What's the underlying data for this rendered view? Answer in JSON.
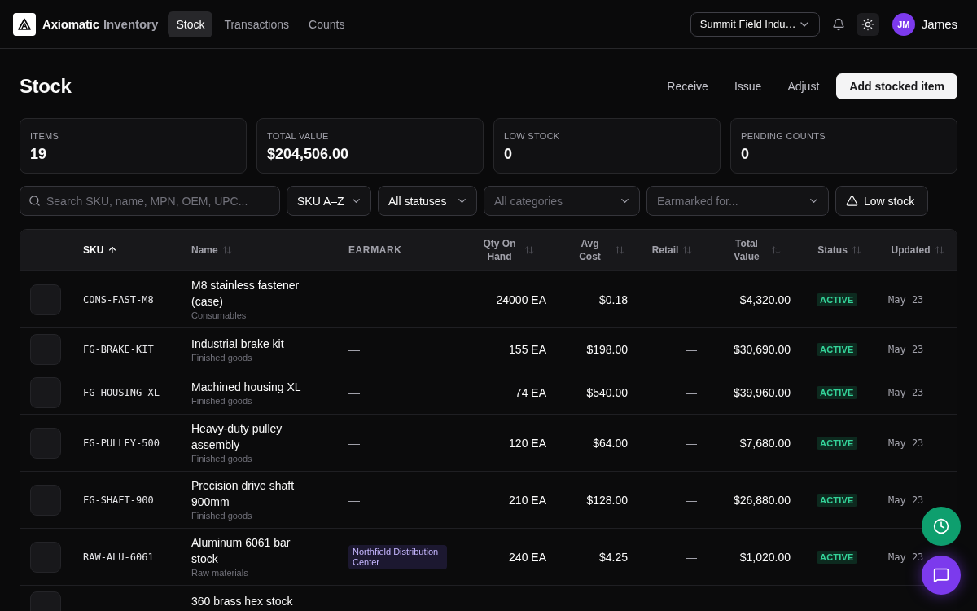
{
  "app": {
    "brand": "Axiomatic",
    "product": "Inventory"
  },
  "nav": {
    "tabs": [
      {
        "label": "Stock",
        "selected": true
      },
      {
        "label": "Transactions",
        "selected": false
      },
      {
        "label": "Counts",
        "selected": false
      }
    ]
  },
  "org_select": {
    "value": "Summit Field Indu…"
  },
  "user": {
    "initials": "JM",
    "name": "James"
  },
  "page": {
    "title": "Stock",
    "actions": [
      {
        "label": "Receive",
        "kind": "ghost"
      },
      {
        "label": "Issue",
        "kind": "ghost"
      },
      {
        "label": "Adjust",
        "kind": "ghost"
      },
      {
        "label": "Add stocked item",
        "kind": "primary"
      }
    ]
  },
  "stats": [
    {
      "label": "ITEMS",
      "value": "19"
    },
    {
      "label": "TOTAL VALUE",
      "value": "$204,506.00"
    },
    {
      "label": "LOW STOCK",
      "value": "0"
    },
    {
      "label": "PENDING COUNTS",
      "value": "0"
    }
  ],
  "filters": {
    "search": {
      "placeholder": "Search SKU, name, MPN, OEM, UPC..."
    },
    "selects": [
      {
        "value": "SKU A–Z"
      },
      {
        "value": "All statuses"
      },
      {
        "placeholder": "All categories"
      },
      {
        "placeholder": "Earmarked for..."
      }
    ],
    "low_stock_button": {
      "label": "Low stock"
    }
  },
  "table": {
    "columns": [
      {
        "label": "SKU",
        "sortable": true,
        "sorted": true
      },
      {
        "label": "Name",
        "sortable": true,
        "sorted": false
      },
      {
        "label": "EARMARK",
        "sortable": false,
        "sorted": false
      },
      {
        "label": "Qty On Hand",
        "sortable": true,
        "sorted": false
      },
      {
        "label": "Avg Cost",
        "sortable": true,
        "sorted": false
      },
      {
        "label": "Retail",
        "sortable": true,
        "sorted": false
      },
      {
        "label": "Total Value",
        "sortable": true,
        "sorted": false
      },
      {
        "label": "Status",
        "sortable": true,
        "sorted": false
      },
      {
        "label": "Updated",
        "sortable": true,
        "sorted": false
      }
    ],
    "rows": [
      {
        "sku": "CONS-FAST-M8",
        "name": "M8 stainless fastener (case)",
        "category": "Consumables",
        "earmark": {
          "kind": "none",
          "text": "—"
        },
        "qty": "24000 EA",
        "avg_cost": "$0.18",
        "retail": "—",
        "total_value": "$4,320.00",
        "status": "ACTIVE",
        "updated": "May 23"
      },
      {
        "sku": "FG-BRAKE-KIT",
        "name": "Industrial brake kit",
        "category": "Finished goods",
        "earmark": {
          "kind": "none",
          "text": "—"
        },
        "qty": "155 EA",
        "avg_cost": "$198.00",
        "retail": "—",
        "total_value": "$30,690.00",
        "status": "ACTIVE",
        "updated": "May 23"
      },
      {
        "sku": "FG-HOUSING-XL",
        "name": "Machined housing XL",
        "category": "Finished goods",
        "earmark": {
          "kind": "none",
          "text": "—"
        },
        "qty": "74 EA",
        "avg_cost": "$540.00",
        "retail": "—",
        "total_value": "$39,960.00",
        "status": "ACTIVE",
        "updated": "May 23"
      },
      {
        "sku": "FG-PULLEY-500",
        "name": "Heavy-duty pulley assembly",
        "category": "Finished goods",
        "earmark": {
          "kind": "none",
          "text": "—"
        },
        "qty": "120 EA",
        "avg_cost": "$64.00",
        "retail": "—",
        "total_value": "$7,680.00",
        "status": "ACTIVE",
        "updated": "May 23"
      },
      {
        "sku": "FG-SHAFT-900",
        "name": "Precision drive shaft 900mm",
        "category": "Finished goods",
        "earmark": {
          "kind": "none",
          "text": "—"
        },
        "qty": "210 EA",
        "avg_cost": "$128.00",
        "retail": "—",
        "total_value": "$26,880.00",
        "status": "ACTIVE",
        "updated": "May 23"
      },
      {
        "sku": "RAW-ALU-6061",
        "name": "Aluminum 6061 bar stock",
        "category": "Raw materials",
        "earmark": {
          "kind": "tag",
          "text": "Northfield Distribution Center"
        },
        "qty": "240 EA",
        "avg_cost": "$4.25",
        "retail": "—",
        "total_value": "$1,020.00",
        "status": "ACTIVE",
        "updated": "May 23"
      },
      {
        "name": "360 brass hex stock"
      }
    ]
  }
}
